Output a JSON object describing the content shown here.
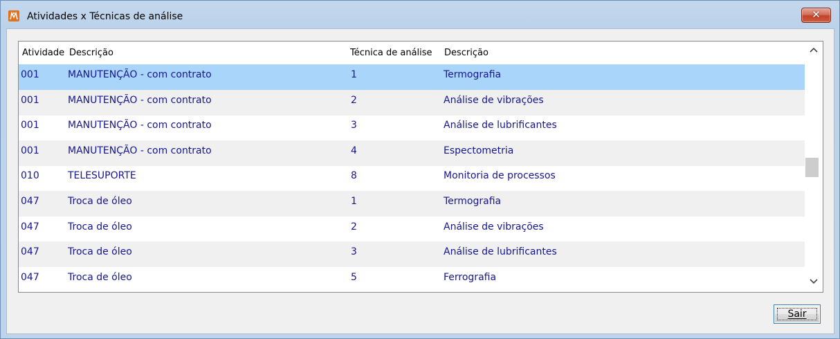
{
  "window": {
    "title": "Atividades x Técnicas de análise",
    "close_symbol": "✕"
  },
  "grid": {
    "columns": [
      "Atividade",
      "Descrição",
      "Técnica de análise",
      "Descrição"
    ],
    "rows": [
      {
        "atividade": "001",
        "descricao": "MANUTENÇÃO - com contrato",
        "tecnica": "1",
        "tecnica_descricao": "Termografia",
        "selected": true
      },
      {
        "atividade": "001",
        "descricao": "MANUTENÇÃO - com contrato",
        "tecnica": "2",
        "tecnica_descricao": "Análise de vibrações"
      },
      {
        "atividade": "001",
        "descricao": "MANUTENÇÃO - com contrato",
        "tecnica": "3",
        "tecnica_descricao": "Análise de lubrificantes"
      },
      {
        "atividade": "001",
        "descricao": "MANUTENÇÃO - com contrato",
        "tecnica": "4",
        "tecnica_descricao": "Espectometria"
      },
      {
        "atividade": "010",
        "descricao": "TELESUPORTE",
        "tecnica": "8",
        "tecnica_descricao": "Monitoria de processos"
      },
      {
        "atividade": "047",
        "descricao": "Troca de óleo",
        "tecnica": "1",
        "tecnica_descricao": "Termografia"
      },
      {
        "atividade": "047",
        "descricao": "Troca de óleo",
        "tecnica": "2",
        "tecnica_descricao": "Análise de vibrações"
      },
      {
        "atividade": "047",
        "descricao": "Troca de óleo",
        "tecnica": "3",
        "tecnica_descricao": "Análise de lubrificantes"
      },
      {
        "atividade": "047",
        "descricao": "Troca de óleo",
        "tecnica": "5",
        "tecnica_descricao": "Ferrografia"
      }
    ]
  },
  "buttons": {
    "sair_label": "Sair"
  },
  "colors": {
    "cell_text": "#15158f",
    "selected_row": "#aad5fa",
    "alt_row": "#f0f0f0"
  },
  "icons": {
    "app": "app-logo-icon",
    "close": "close-icon",
    "scroll_up": "chevron-up-icon",
    "scroll_down": "chevron-down-icon"
  }
}
